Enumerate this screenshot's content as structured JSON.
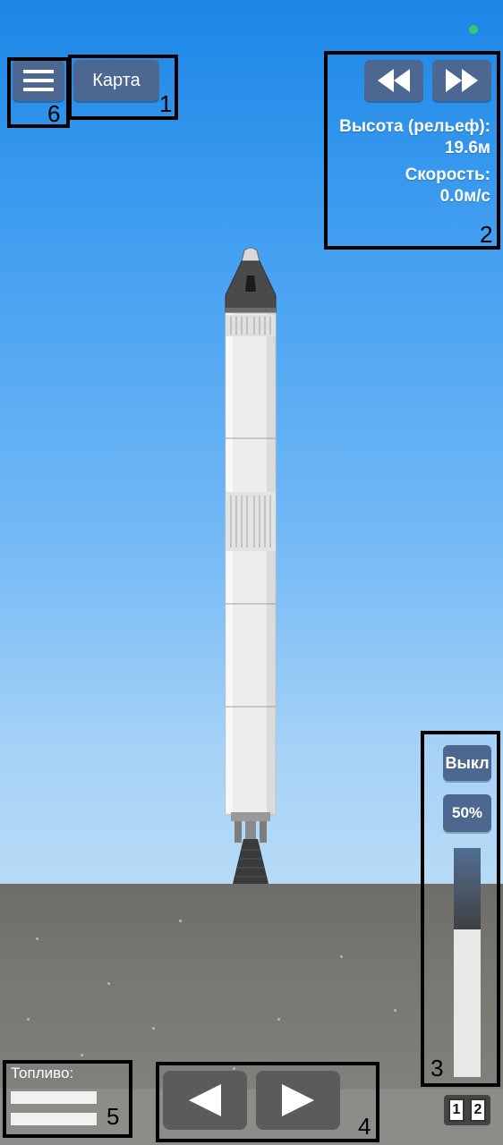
{
  "colors": {
    "button_bg": "#4c6790",
    "status_dot": "#2ecc71",
    "frame": "#000000"
  },
  "map_button": {
    "label": "Карта",
    "annotation": "1"
  },
  "menu_button": {
    "icon": "hamburger-menu-icon",
    "annotation": "6"
  },
  "time_controls": {
    "rewind_icon": "rewind-icon",
    "fast_forward_icon": "fast-forward-icon",
    "annotation": "2"
  },
  "telemetry": {
    "altitude_label": "Высота (рельеф):",
    "altitude_value": "19.6м",
    "speed_label": "Скорость:",
    "speed_value": "0.0м/с"
  },
  "throttle": {
    "toggle_label": "Выкл",
    "percent_label": "50%",
    "level": 0.5,
    "annotation": "3"
  },
  "rotation_controls": {
    "left_icon": "rotate-left-arrow-icon",
    "right_icon": "rotate-right-arrow-icon",
    "annotation": "4"
  },
  "fuel": {
    "label": "Топливо:",
    "annotation": "5"
  },
  "stages": {
    "stage_1": "1",
    "stage_2": "2"
  }
}
